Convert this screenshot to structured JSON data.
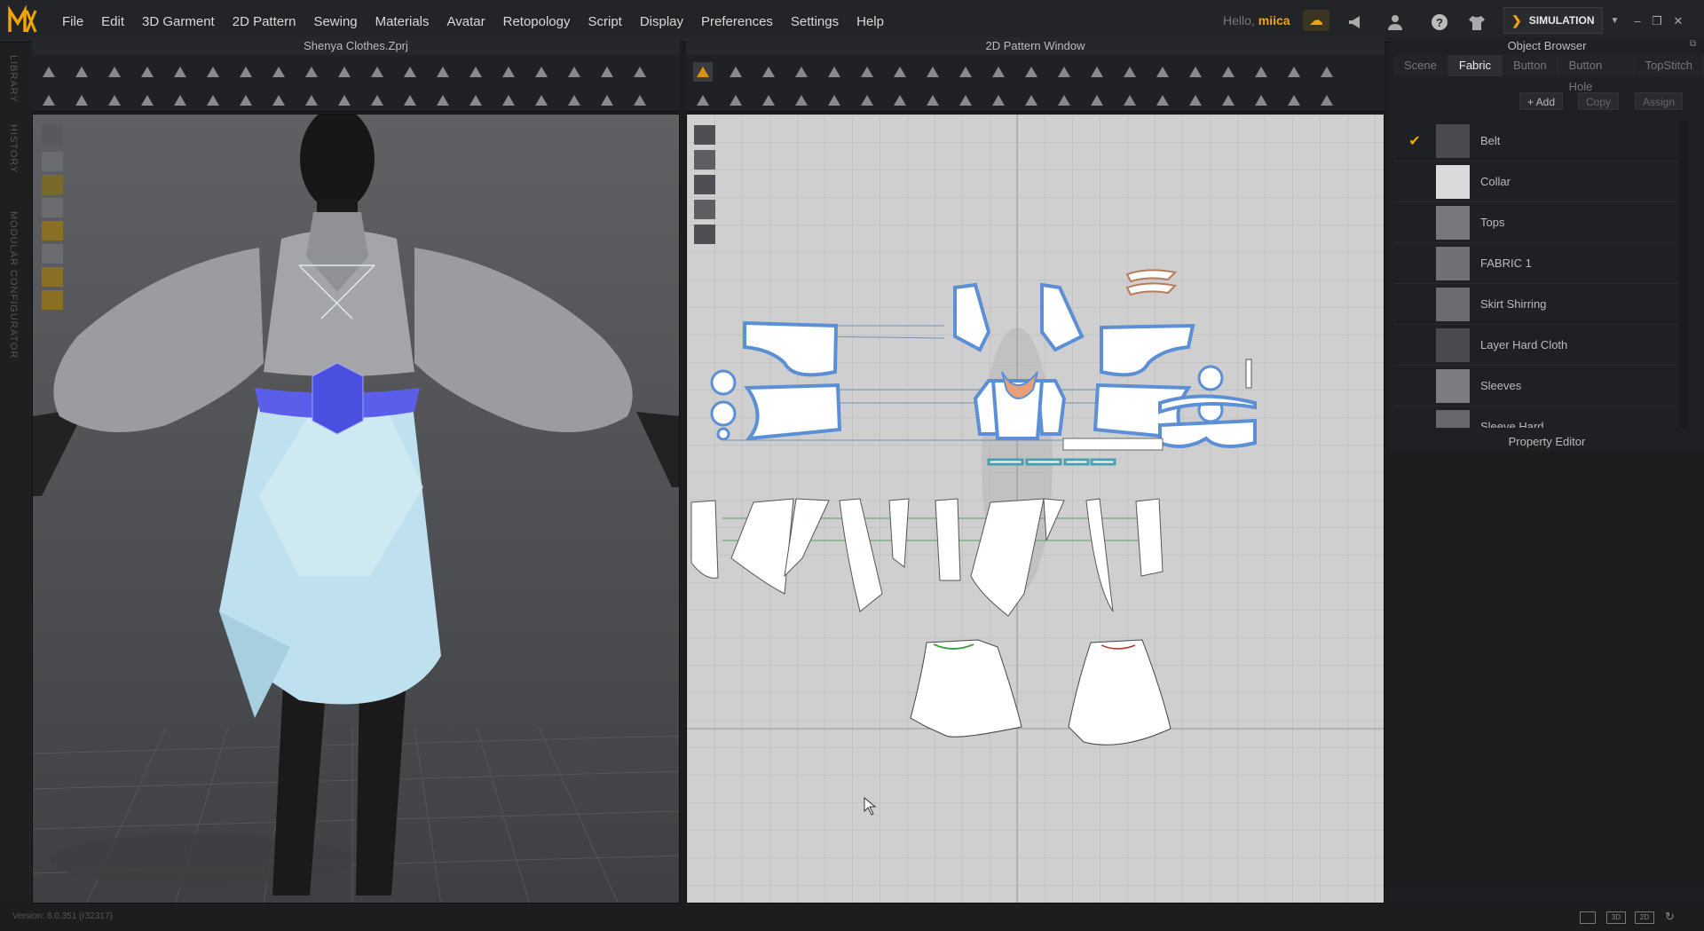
{
  "menubar": {
    "items": [
      "File",
      "Edit",
      "3D Garment",
      "2D Pattern",
      "Sewing",
      "Materials",
      "Avatar",
      "Retopology",
      "Script",
      "Display",
      "Preferences",
      "Settings",
      "Help"
    ],
    "hello_label": "Hello,",
    "user_name": "miica",
    "simulation_label": "SIMULATION"
  },
  "left_rail": {
    "labels": [
      "LIBRARY",
      "HISTORY",
      "MODULAR CONFIGURATOR"
    ]
  },
  "panels": {
    "viewport3d_title": "Shenya Clothes.Zprj",
    "pattern_title": "2D Pattern Window",
    "object_browser_title": "Object Browser",
    "property_editor_title": "Property Editor"
  },
  "object_browser": {
    "tabs": [
      "Scene",
      "Fabric",
      "Button",
      "Button Hole",
      "TopStitch"
    ],
    "active_tab": "Fabric",
    "add_label": "+ Add",
    "copy_label": "Copy",
    "assign_label": "Assign",
    "fabrics": [
      {
        "name": "Belt",
        "checked": true,
        "color": "#4a4b4e"
      },
      {
        "name": "Collar",
        "checked": false,
        "color": "#d8dadc"
      },
      {
        "name": "Tops",
        "checked": false,
        "color": "#76787b"
      },
      {
        "name": "FABRIC 1",
        "checked": false,
        "color": "#6f7174"
      },
      {
        "name": "Skirt Shirring",
        "checked": false,
        "color": "#6a6c6f"
      },
      {
        "name": "Layer Hard Cloth",
        "checked": false,
        "color": "#484a4d"
      },
      {
        "name": "Sleeves",
        "checked": false,
        "color": "#7b7d80"
      },
      {
        "name": "Sleeve Hard",
        "checked": false,
        "color": "#66686b"
      }
    ]
  },
  "statusbar": {
    "version": "Version: 6.0.351 (r32317)"
  },
  "colors": {
    "accent": "#f0a500",
    "selection_blue": "#5b8fd6",
    "belt_blue": "#5a5ee8",
    "skirt_light_blue": "#bfe0ee"
  }
}
